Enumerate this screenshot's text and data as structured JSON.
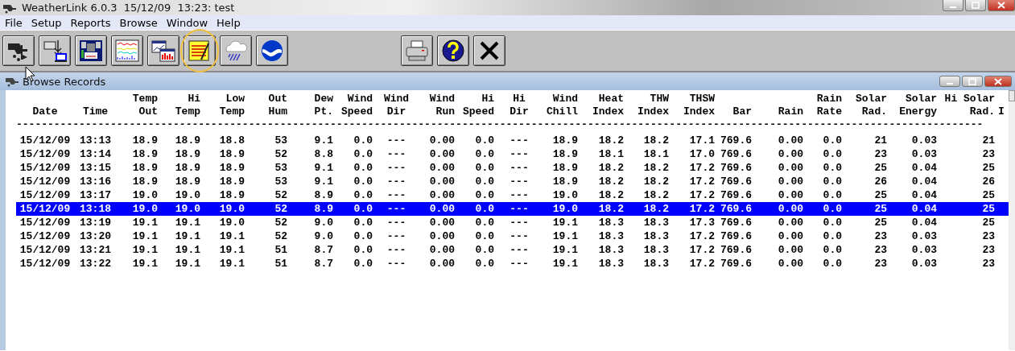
{
  "window": {
    "title": "WeatherLink 6.0.3  15/12/09  13:23: test"
  },
  "menu": [
    {
      "label": "File"
    },
    {
      "label": "Setup"
    },
    {
      "label": "Reports"
    },
    {
      "label": "Browse"
    },
    {
      "label": "Window"
    },
    {
      "label": "Help"
    }
  ],
  "toolbar": {
    "left": [
      {
        "kind": "station",
        "highlighted": false
      },
      {
        "kind": "download",
        "highlighted": false
      },
      {
        "kind": "bulletin",
        "highlighted": false
      },
      {
        "kind": "strip",
        "highlighted": false
      },
      {
        "kind": "graph",
        "highlighted": false
      },
      {
        "kind": "notepad",
        "highlighted": true
      },
      {
        "kind": "rain",
        "highlighted": false
      },
      {
        "kind": "emblem",
        "highlighted": false
      }
    ],
    "right": [
      {
        "kind": "print",
        "highlighted": false
      },
      {
        "kind": "help",
        "highlighted": false
      },
      {
        "kind": "exit",
        "highlighted": false
      }
    ]
  },
  "browse_window": {
    "title": "Browse Records",
    "table": {
      "columns": [
        {
          "bottom": "Date"
        },
        {
          "bottom": "Time"
        },
        {
          "top": "Temp",
          "bottom": "Out"
        },
        {
          "top": "Hi",
          "bottom": "Temp"
        },
        {
          "top": "Low",
          "bottom": "Temp"
        },
        {
          "top": "Out",
          "bottom": "Hum"
        },
        {
          "top": "Dew",
          "bottom": "Pt."
        },
        {
          "top": "Wind",
          "bottom": "Speed"
        },
        {
          "top": "Wind",
          "bottom": "Dir"
        },
        {
          "top": "Wind",
          "bottom": "Run"
        },
        {
          "top": "Hi",
          "bottom": "Speed"
        },
        {
          "top": "Hi",
          "bottom": "Dir"
        },
        {
          "top": "Wind",
          "bottom": "Chill"
        },
        {
          "top": "Heat",
          "bottom": "Index"
        },
        {
          "top": "THW",
          "bottom": "Index"
        },
        {
          "top": "THSW",
          "bottom": "Index"
        },
        {
          "bottom": "Bar"
        },
        {
          "bottom": "Rain"
        },
        {
          "top": "Rain",
          "bottom": "Rate"
        },
        {
          "top": "Solar",
          "bottom": "Rad."
        },
        {
          "top": "Solar",
          "bottom": "Energy"
        },
        {
          "top": "Hi Solar",
          "bottom": "Rad."
        },
        {
          "bottom": "I"
        }
      ],
      "separator": "----------------------------------------------------------------------------------------------------------------------------------------------------------",
      "rows": [
        {
          "selected": false,
          "cells": [
            "15/12/09",
            "13:13",
            "18.9",
            "18.9",
            "18.8",
            "53",
            "9.1",
            "0.0",
            "---",
            "0.00",
            "0.0",
            "---",
            "18.9",
            "18.2",
            "18.2",
            "17.1",
            "769.6",
            "0.00",
            "0.0",
            "21",
            "0.03",
            "21"
          ]
        },
        {
          "selected": false,
          "cells": [
            "15/12/09",
            "13:14",
            "18.9",
            "18.9",
            "18.9",
            "52",
            "8.8",
            "0.0",
            "---",
            "0.00",
            "0.0",
            "---",
            "18.9",
            "18.1",
            "18.1",
            "17.0",
            "769.6",
            "0.00",
            "0.0",
            "23",
            "0.03",
            "23"
          ]
        },
        {
          "selected": false,
          "cells": [
            "15/12/09",
            "13:15",
            "18.9",
            "18.9",
            "18.9",
            "53",
            "9.1",
            "0.0",
            "---",
            "0.00",
            "0.0",
            "---",
            "18.9",
            "18.2",
            "18.2",
            "17.2",
            "769.6",
            "0.00",
            "0.0",
            "25",
            "0.04",
            "25"
          ]
        },
        {
          "selected": false,
          "cells": [
            "15/12/09",
            "13:16",
            "18.9",
            "18.9",
            "18.9",
            "53",
            "9.1",
            "0.0",
            "---",
            "0.00",
            "0.0",
            "---",
            "18.9",
            "18.2",
            "18.2",
            "17.2",
            "769.6",
            "0.00",
            "0.0",
            "26",
            "0.04",
            "26"
          ]
        },
        {
          "selected": false,
          "cells": [
            "15/12/09",
            "13:17",
            "19.0",
            "19.0",
            "18.9",
            "52",
            "8.9",
            "0.0",
            "---",
            "0.00",
            "0.0",
            "---",
            "19.0",
            "18.2",
            "18.2",
            "17.2",
            "769.6",
            "0.00",
            "0.0",
            "25",
            "0.04",
            "25"
          ]
        },
        {
          "selected": true,
          "cells": [
            "15/12/09",
            "13:18",
            "19.0",
            "19.0",
            "19.0",
            "52",
            "8.9",
            "0.0",
            "---",
            "0.00",
            "0.0",
            "---",
            "19.0",
            "18.2",
            "18.2",
            "17.2",
            "769.6",
            "0.00",
            "0.0",
            "25",
            "0.04",
            "25"
          ]
        },
        {
          "selected": false,
          "cells": [
            "15/12/09",
            "13:19",
            "19.1",
            "19.1",
            "19.0",
            "52",
            "9.0",
            "0.0",
            "---",
            "0.00",
            "0.0",
            "---",
            "19.1",
            "18.3",
            "18.3",
            "17.3",
            "769.6",
            "0.00",
            "0.0",
            "25",
            "0.04",
            "25"
          ]
        },
        {
          "selected": false,
          "cells": [
            "15/12/09",
            "13:20",
            "19.1",
            "19.1",
            "19.1",
            "52",
            "9.0",
            "0.0",
            "---",
            "0.00",
            "0.0",
            "---",
            "19.1",
            "18.3",
            "18.3",
            "17.2",
            "769.6",
            "0.00",
            "0.0",
            "23",
            "0.03",
            "23"
          ]
        },
        {
          "selected": false,
          "cells": [
            "15/12/09",
            "13:21",
            "19.1",
            "19.1",
            "19.1",
            "51",
            "8.7",
            "0.0",
            "---",
            "0.00",
            "0.0",
            "---",
            "19.1",
            "18.3",
            "18.3",
            "17.2",
            "769.6",
            "0.00",
            "0.0",
            "23",
            "0.03",
            "23"
          ]
        },
        {
          "selected": false,
          "cells": [
            "15/12/09",
            "13:22",
            "19.1",
            "19.1",
            "19.1",
            "51",
            "8.7",
            "0.0",
            "---",
            "0.00",
            "0.0",
            "---",
            "19.1",
            "18.3",
            "18.3",
            "17.2",
            "769.6",
            "0.00",
            "0.0",
            "23",
            "0.03",
            "23"
          ]
        }
      ]
    }
  }
}
